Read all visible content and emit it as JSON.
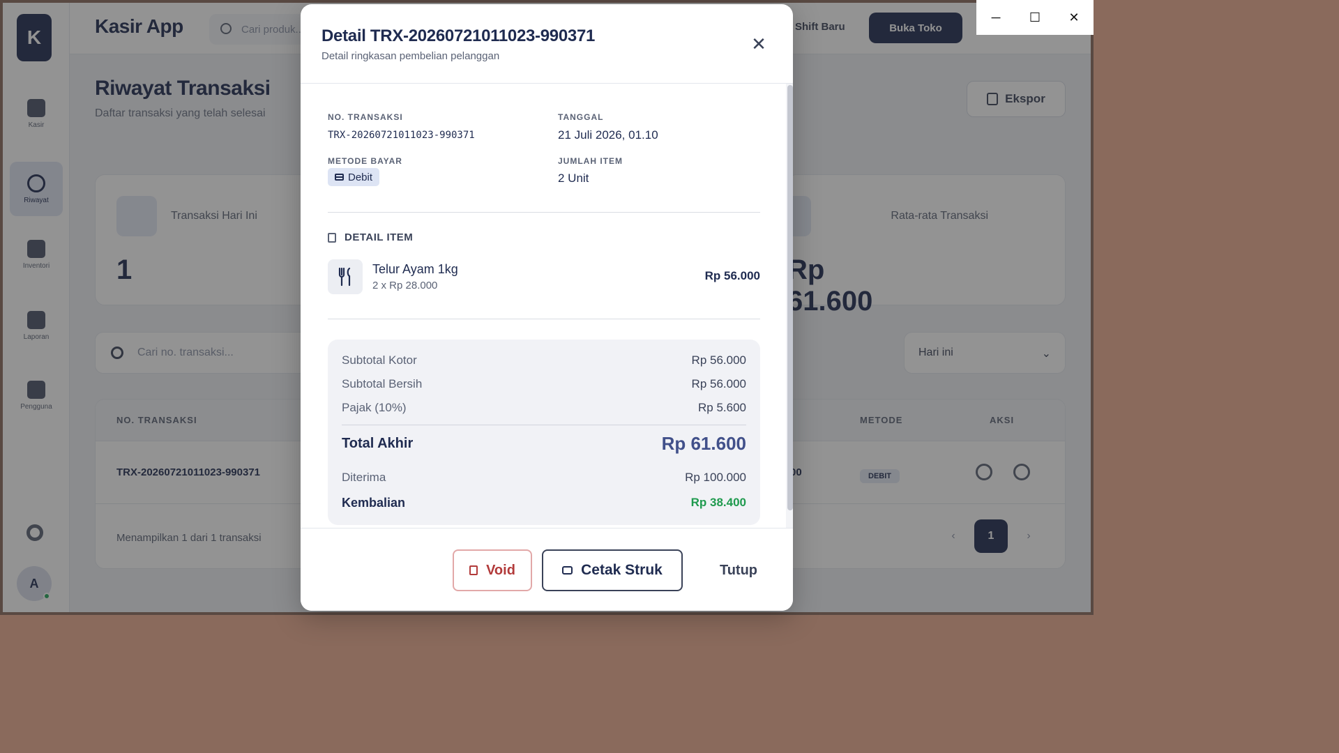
{
  "background": {
    "app_title": "Kasir App",
    "top_search_placeholder": "Cari produk...",
    "top_link": "Shift Baru",
    "open_store_button": "Buka Toko",
    "nav": [
      {
        "label": "Kasir",
        "icon": "cart-icon"
      },
      {
        "label": "Riwayat",
        "icon": "history-icon"
      },
      {
        "label": "Inventori",
        "icon": "box-icon"
      },
      {
        "label": "Laporan",
        "icon": "chart-icon"
      },
      {
        "label": "Pengguna",
        "icon": "users-icon"
      }
    ],
    "avatar_initial": "A",
    "page_title": "Riwayat Transaksi",
    "page_subtitle": "Daftar transaksi yang telah selesai",
    "export_button": "Ekspor",
    "stat_left": {
      "label": "Transaksi Hari Ini",
      "value": "1"
    },
    "stat_right": {
      "label": "Rata-rata Transaksi",
      "value": "Rp 61.600"
    },
    "filter_search_placeholder": "Cari no. transaksi...",
    "filter_period": "Hari ini",
    "table_headers": {
      "no": "NO. TRANSAKSI",
      "method": "METODE",
      "action": "AKSI"
    },
    "table_row": {
      "no": "TRX-20260721011023-990371",
      "total_fragment": "00",
      "method": "DEBIT"
    },
    "table_footer": "Menampilkan 1 dari 1 transaksi",
    "current_page": "1"
  },
  "window": {
    "minimize": "─",
    "maximize": "☐",
    "close": "✕"
  },
  "modal": {
    "title": "Detail TRX-20260721011023-990371",
    "subtitle": "Detail ringkasan pembelian pelanggan",
    "close_glyph": "✕",
    "fields": {
      "no_label": "NO. TRANSAKSI",
      "no_value": "TRX-20260721011023-990371",
      "date_label": "TANGGAL",
      "date_value": "21 Juli 2026, 01.10",
      "method_label": "METODE BAYAR",
      "method_value": "Debit",
      "items_label": "JUMLAH ITEM",
      "items_value": "2 Unit"
    },
    "section_items": "DETAIL ITEM",
    "items": [
      {
        "name": "Telur Ayam 1kg",
        "qty": "2 x Rp 28.000",
        "price": "Rp 56.000",
        "icon": "utensils-icon"
      }
    ],
    "summary": {
      "gross_label": "Subtotal Kotor",
      "gross_value": "Rp 56.000",
      "net_label": "Subtotal Bersih",
      "net_value": "Rp 56.000",
      "tax_label": "Pajak (10%)",
      "tax_value": "Rp 5.600",
      "total_label": "Total Akhir",
      "total_value": "Rp 61.600",
      "received_label": "Diterima",
      "received_value": "Rp 100.000",
      "change_label": "Kembalian",
      "change_value": "Rp 38.400"
    },
    "buttons": {
      "void": "Void",
      "print": "Cetak Struk",
      "close": "Tutup"
    }
  },
  "colors": {
    "primary": "#1f2b50",
    "accent": "#41508a",
    "success": "#1f9a4e",
    "danger": "#b23a3a"
  }
}
